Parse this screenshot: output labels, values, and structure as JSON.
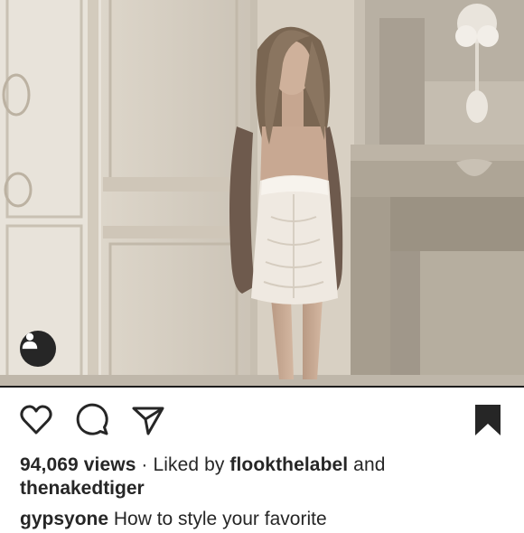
{
  "post": {
    "views_count": "94,069 views",
    "separator": " · ",
    "liked_by_prefix": "Liked by ",
    "liked_user_1": "flookthelabel",
    "conjunction": " and",
    "liked_user_2": "thenakedtiger",
    "caption_user": "gypsyone",
    "caption_text": " How to style your favorite"
  },
  "icons": {
    "user_tag": "user-silhouette-icon",
    "like": "heart-outline-icon",
    "comment": "speech-bubble-icon",
    "share": "paper-plane-icon",
    "save": "bookmark-filled-icon"
  },
  "colors": {
    "text": "#262626",
    "icon": "#262626",
    "tag_badge": "#262626",
    "background": "#ffffff"
  }
}
